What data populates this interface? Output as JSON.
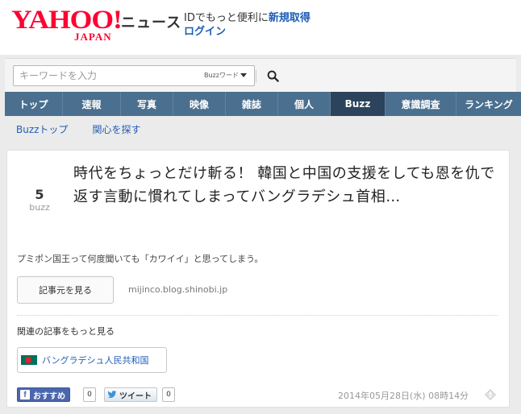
{
  "header": {
    "logo_main": "YAHOO!",
    "logo_sub": "JAPAN",
    "service_name": "ニュース",
    "id_text": "IDでもっと便利に",
    "register_link": "新規取得",
    "login_link": "ログイン"
  },
  "search": {
    "placeholder": "キーワードを入力",
    "scope_label": "Buzzワード",
    "icon": "search-icon"
  },
  "nav": {
    "items": [
      {
        "label": "トップ",
        "active": false
      },
      {
        "label": "速報",
        "active": false
      },
      {
        "label": "写真",
        "active": false
      },
      {
        "label": "映像",
        "active": false
      },
      {
        "label": "雑誌",
        "active": false
      },
      {
        "label": "個人",
        "active": false
      },
      {
        "label": "Buzz",
        "active": true
      },
      {
        "label": "意識調査",
        "active": false
      },
      {
        "label": "ランキング",
        "active": false
      }
    ]
  },
  "subnav": {
    "items": [
      "Buzzトップ",
      "関心を探す"
    ]
  },
  "article": {
    "buzz_count": "5",
    "buzz_unit": "buzz",
    "title": "時代をちょっとだけ斬る！ 韓国と中国の支援をしても恩を仇で返す言動に慣れてしまってバングラデシュ首相…",
    "description": "プミポン国王って何度聞いても「カワイイ」と思ってしまう。",
    "source_button": "記事元を見る",
    "source_domain": "mijinco.blog.shinobi.jp",
    "related_heading": "関連の記事をもっと見る",
    "related_tag": "バングラデシュ人民共和国",
    "related_tag_icon": "bangladesh-flag-icon"
  },
  "social": {
    "facebook_icon": "f",
    "facebook_label": "おすすめ",
    "facebook_count": "0",
    "twitter_label": "ツイート",
    "twitter_count": "0"
  },
  "timestamp": "2014年05月28日(水) 08時14分",
  "colors": {
    "brand": "#ff0033",
    "nav_bg": "#4b6f8e",
    "nav_active": "#2b435b",
    "link": "#1f5db6"
  }
}
